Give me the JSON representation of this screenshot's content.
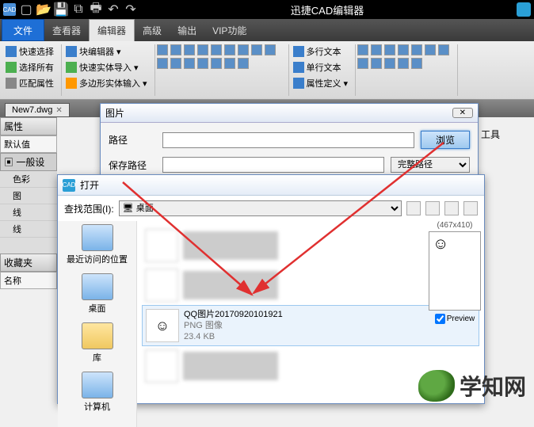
{
  "app": {
    "title": "迅捷CAD编辑器",
    "logo_text": "CAD"
  },
  "menubar": {
    "file": "文件",
    "items": [
      "查看器",
      "编辑器",
      "高级",
      "输出",
      "VIP功能"
    ],
    "active_index": 1
  },
  "ribbon": {
    "group1": [
      {
        "icon": "ico-blue",
        "label": "快速选择"
      },
      {
        "icon": "ico-green",
        "label": "选择所有"
      },
      {
        "icon": "ico-gray",
        "label": "匹配属性"
      }
    ],
    "group2": [
      {
        "icon": "ico-blue",
        "label": "块编辑器"
      },
      {
        "icon": "ico-green",
        "label": "快速实体导入"
      },
      {
        "icon": "ico-orange",
        "label": "多边形实体输入"
      }
    ],
    "group3": [
      {
        "icon": "ico-blue",
        "label": "多行文本"
      },
      {
        "icon": "ico-blue",
        "label": "单行文本"
      },
      {
        "icon": "ico-blue",
        "label": "属性定义"
      }
    ]
  },
  "doc_tab": {
    "name": "New7.dwg"
  },
  "props": {
    "header": "属性",
    "default": "默认值",
    "section": "一般设",
    "items": [
      "色彩",
      "图",
      "线",
      "线"
    ],
    "fav_header": "收藏夹",
    "name_header": "名称"
  },
  "dlg_img": {
    "title": "图片",
    "path_label": "路径",
    "save_label": "保存路径",
    "browse": "浏览",
    "full_path": "完整路径",
    "tools": "工具"
  },
  "dlg_open": {
    "title": "打开",
    "range_label": "查找范围(I):",
    "range_value": "桌面",
    "places": [
      {
        "label": "最近访问的位置",
        "cls": ""
      },
      {
        "label": "桌面",
        "cls": ""
      },
      {
        "label": "库",
        "cls": "folder"
      },
      {
        "label": "计算机",
        "cls": ""
      }
    ],
    "selected_file": {
      "name": "QQ图片20170920101921",
      "type": "PNG 图像",
      "size": "23.4 KB"
    },
    "preview_dim": "(467x410)",
    "preview_label": "Preview"
  },
  "watermark": "学知网"
}
